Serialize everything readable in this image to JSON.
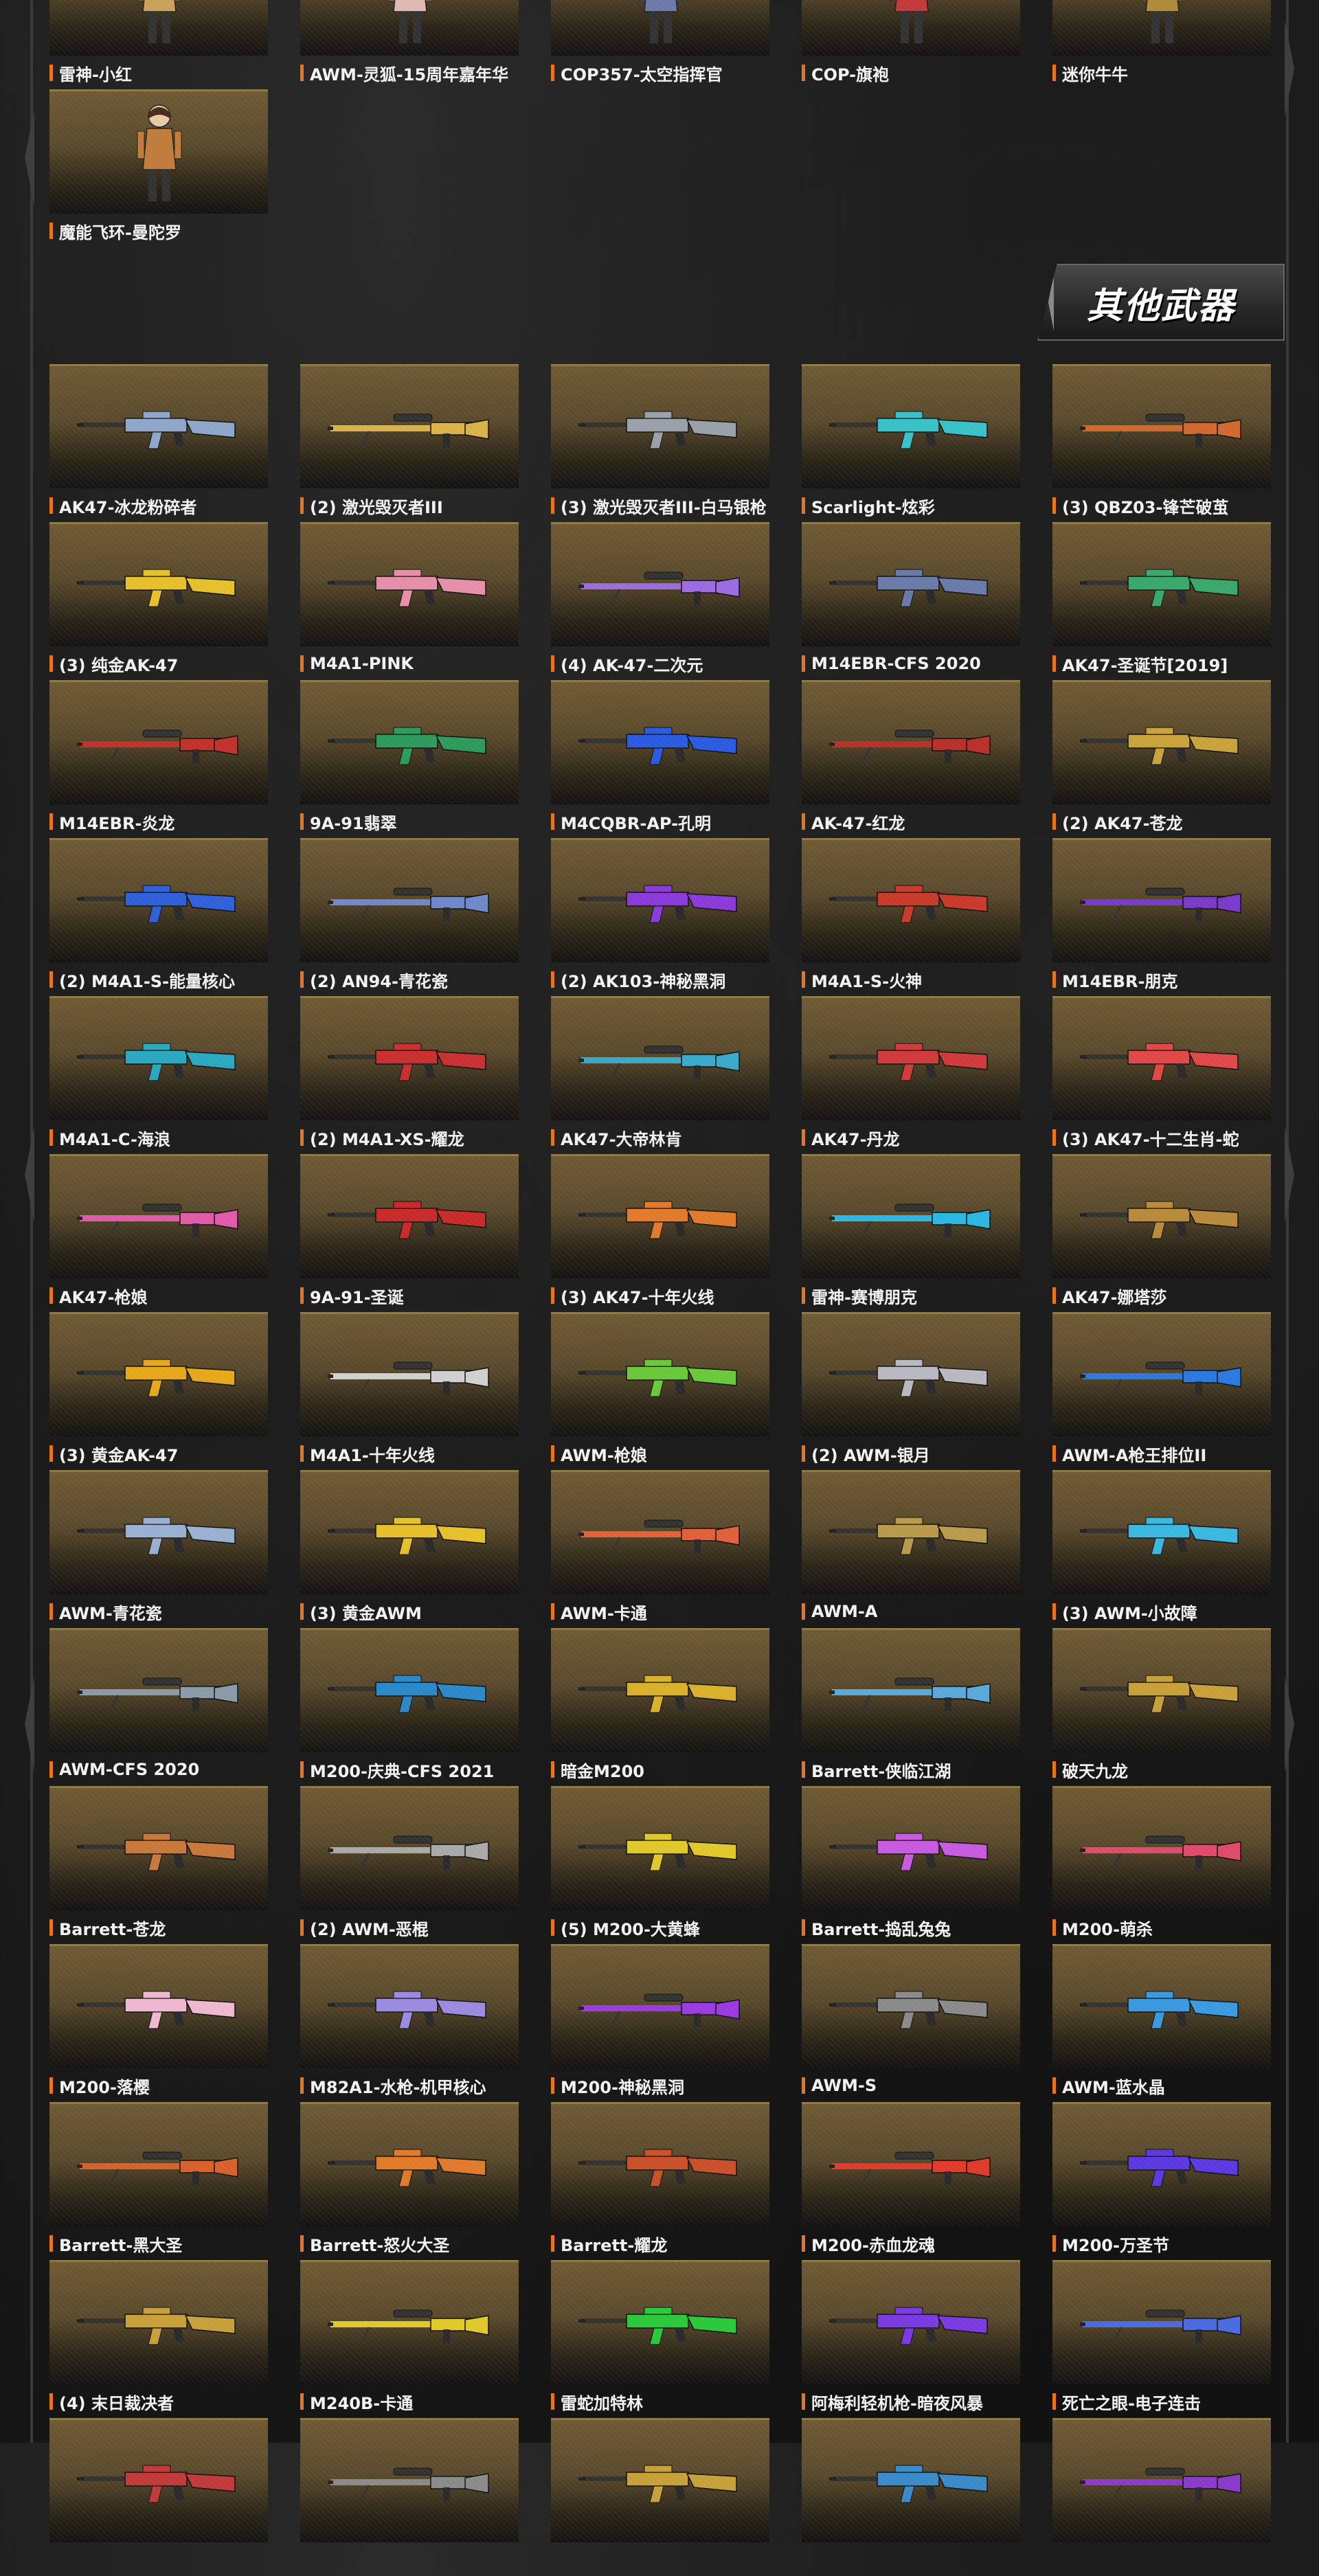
{
  "section_title": "其他武器",
  "top_row": [
    {
      "name": "雷神-小红",
      "kind": "character",
      "color": "#c9a15a"
    },
    {
      "name": "AWM-灵狐-15周年嘉年华",
      "kind": "character",
      "color": "#e0b9b0"
    },
    {
      "name": "COP357-太空指挥官",
      "kind": "character",
      "color": "#6d7aa8"
    },
    {
      "name": "COP-旗袍",
      "kind": "character",
      "color": "#c23a3a"
    },
    {
      "name": "迷你牛牛",
      "kind": "character",
      "color": "#b08a3a"
    }
  ],
  "second_row": [
    {
      "name": "魔能飞环-曼陀罗",
      "kind": "character",
      "color": "#c07c3a"
    }
  ],
  "weapons": [
    {
      "name": "AK47-冰龙粉碎者",
      "color": "#8fa6c8"
    },
    {
      "name": "(2) 激光毁灭者III",
      "color": "#d9b24a"
    },
    {
      "name": "(3) 激光毁灭者III-白马银枪",
      "color": "#9aa0aa"
    },
    {
      "name": "Scarlight-炫彩",
      "color": "#39c1c8"
    },
    {
      "name": "(3) QBZ03-锋芒破茧",
      "color": "#d0682f"
    },
    {
      "name": "(3) 纯金AK-47",
      "color": "#e6c02a"
    },
    {
      "name": "M4A1-PINK",
      "color": "#e58fa8"
    },
    {
      "name": "(4) AK-47-二次元",
      "color": "#9b6be0"
    },
    {
      "name": "M14EBR-CFS 2020",
      "color": "#6a7aa8"
    },
    {
      "name": "AK47-圣诞节[2019]",
      "color": "#3aa86a"
    },
    {
      "name": "M14EBR-炎龙",
      "color": "#c0322a"
    },
    {
      "name": "9A-91翡翠",
      "color": "#2e9a5a"
    },
    {
      "name": "M4CQBR-AP-孔明",
      "color": "#2a5ae0"
    },
    {
      "name": "AK-47-红龙",
      "color": "#b8302a"
    },
    {
      "name": "(2) AK47-苍龙",
      "color": "#c8a23a"
    },
    {
      "name": "(2) M4A1-S-能量核心",
      "color": "#3060d8"
    },
    {
      "name": "(2) AN94-青花瓷",
      "color": "#6e88c8"
    },
    {
      "name": "(2) AK103-神秘黑洞",
      "color": "#8a3ad8"
    },
    {
      "name": "M4A1-S-火神",
      "color": "#c83a2a"
    },
    {
      "name": "M14EBR-朋克",
      "color": "#7a3ac8"
    },
    {
      "name": "M4A1-C-海浪",
      "color": "#2aa8c0"
    },
    {
      "name": "(2) M4A1-XS-耀龙",
      "color": "#c83030"
    },
    {
      "name": "AK47-大帝林肯",
      "color": "#3aa8c8"
    },
    {
      "name": "AK47-丹龙",
      "color": "#d03a3a"
    },
    {
      "name": "(3) AK47-十二生肖-蛇",
      "color": "#e04848"
    },
    {
      "name": "AK47-枪娘",
      "color": "#e05aa8"
    },
    {
      "name": "9A-91-圣诞",
      "color": "#c82a2a"
    },
    {
      "name": "(3) AK47-十年火线",
      "color": "#e07a2a"
    },
    {
      "name": "雷神-赛博朋克",
      "color": "#2ab8e0"
    },
    {
      "name": "AK47-娜塔莎",
      "color": "#b88a3a"
    },
    {
      "name": "(3) 黄金AK-47",
      "color": "#e6a81a"
    },
    {
      "name": "M4A1-十年火线",
      "color": "#d0d0d0"
    },
    {
      "name": "AWM-枪娘",
      "color": "#6ac83a"
    },
    {
      "name": "(2) AWM-银月",
      "color": "#b8b8c0"
    },
    {
      "name": "AWM-A枪王排位II",
      "color": "#2a78e0"
    },
    {
      "name": "AWM-青花瓷",
      "color": "#9ab0d0"
    },
    {
      "name": "(3) 黄金AWM",
      "color": "#e6c02a"
    },
    {
      "name": "AWM-卡通",
      "color": "#e0603a"
    },
    {
      "name": "AWM-A",
      "color": "#b89a4a"
    },
    {
      "name": "(3) AWM-小故障",
      "color": "#3ab8e0"
    },
    {
      "name": "AWM-CFS 2020",
      "color": "#8a9aa8"
    },
    {
      "name": "M200-庆典-CFS 2021",
      "color": "#2a88c8"
    },
    {
      "name": "暗金M200",
      "color": "#d8b02a"
    },
    {
      "name": "Barrett-侠临江湖",
      "color": "#5aa8d8"
    },
    {
      "name": "破天九龙",
      "color": "#c8a03a"
    },
    {
      "name": "Barrett-苍龙",
      "color": "#c8783a"
    },
    {
      "name": "(2) AWM-恶棍",
      "color": "#a8a8a8"
    },
    {
      "name": "(5) M200-大黄蜂",
      "color": "#e0c82a"
    },
    {
      "name": "Barrett-捣乱兔兔",
      "color": "#c85ae0"
    },
    {
      "name": "M200-萌杀",
      "color": "#e04a6a"
    },
    {
      "name": "M200-落樱",
      "color": "#f0b8d0"
    },
    {
      "name": "M82A1-水枪-机甲核心",
      "color": "#9a8ae0"
    },
    {
      "name": "M200-神秘黑洞",
      "color": "#9a3ae0"
    },
    {
      "name": "AWM-S",
      "color": "#8a8a8a"
    },
    {
      "name": "AWM-蓝水晶",
      "color": "#3a9ae0"
    },
    {
      "name": "Barrett-黑大圣",
      "color": "#d8602a"
    },
    {
      "name": "Barrett-怒火大圣",
      "color": "#e07a2a"
    },
    {
      "name": "Barrett-耀龙",
      "color": "#c8502a"
    },
    {
      "name": "M200-赤血龙魂",
      "color": "#e03a2a"
    },
    {
      "name": "M200-万圣节",
      "color": "#5a3ae0"
    },
    {
      "name": "(4) 末日裁决者",
      "color": "#c8a03a"
    },
    {
      "name": "M240B-卡通",
      "color": "#e0c82a"
    },
    {
      "name": "雷蛇加特林",
      "color": "#2ac83a"
    },
    {
      "name": "阿梅利轻机枪-暗夜风暴",
      "color": "#7a3ae0"
    },
    {
      "name": "死亡之眼-电子连击",
      "color": "#4a6ae0"
    }
  ],
  "partial_row_colors": [
    "#c03a3a",
    "#8a8a8a",
    "#c8a03a",
    "#3a8ac8",
    "#8a3ac8"
  ]
}
